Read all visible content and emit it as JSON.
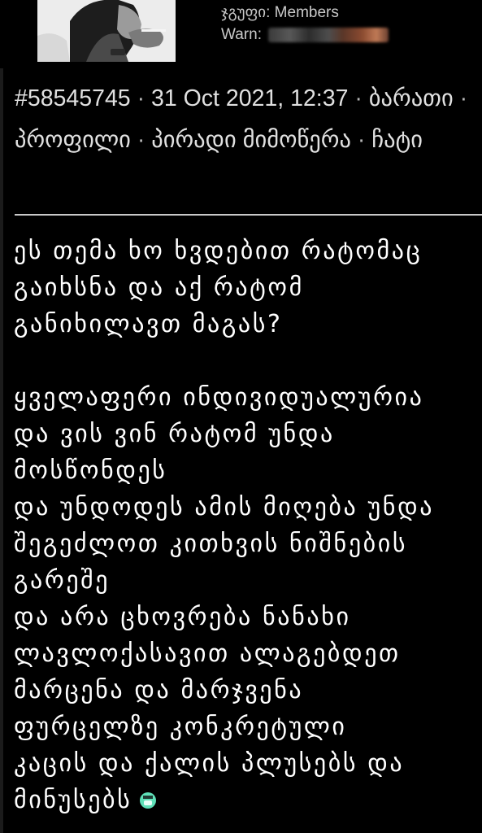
{
  "user": {
    "group_label": "ჯგუფი:",
    "group_value": "Members",
    "warn_label": "Warn:"
  },
  "post": {
    "id": "#58545745",
    "date": "31 Oct 2021, 12:37",
    "links": [
      "ბარათი",
      "პროფილი",
      "პირადი მიმოწერა",
      "ჩატი"
    ],
    "sep": "·",
    "paragraph1": [
      "ეს თემა ხო ხვდებით რატომაც",
      "გაიხსნა და აქ რატომ",
      "განიხილავთ მაგას?"
    ],
    "paragraph2": [
      "ყველაფერი ინდივიდუალურია",
      "და ვის ვინ რატომ უნდა",
      "მოსწონდეს",
      "და უნდოდეს ამის მიღება უნდა",
      "შეგეძლოთ კითხვის ნიშნების",
      "გარეშე",
      "და არა ცხოვრება ნანახი",
      "ლავლოქასავით ალაგებდეთ",
      "მარცენა და მარჯვენა",
      "ფურცელზე კონკრეტული",
      "კაცის და ქალის პლუსებს და",
      "მინუსებს"
    ],
    "emoji_name": "smile-emoji-icon"
  }
}
